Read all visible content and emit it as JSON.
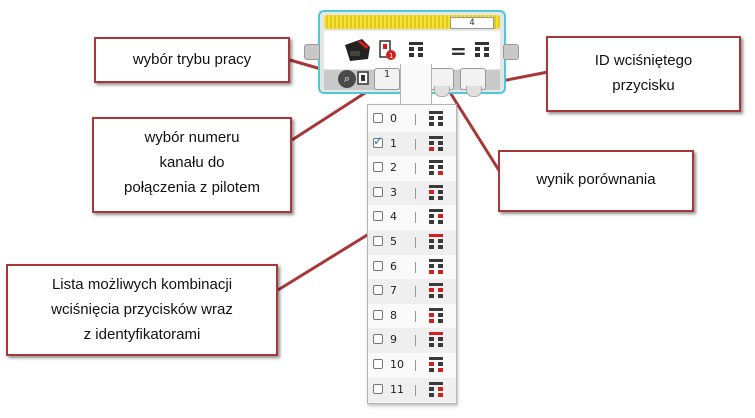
{
  "block": {
    "port_value": "4",
    "channel_value": "1",
    "colors": {
      "border": "#4fc8d8",
      "header": "#f4e23a",
      "button_off": "#3a3a3a",
      "button_on": "#d21f1f"
    }
  },
  "dropdown": {
    "rows": [
      {
        "label": "0",
        "checked": false,
        "pattern": [
          0,
          0,
          0,
          0,
          0
        ]
      },
      {
        "label": "1",
        "checked": true,
        "pattern": [
          0,
          0,
          0,
          1,
          0
        ]
      },
      {
        "label": "2",
        "checked": false,
        "pattern": [
          0,
          0,
          0,
          0,
          1
        ]
      },
      {
        "label": "3",
        "checked": false,
        "pattern": [
          0,
          1,
          0,
          0,
          0
        ]
      },
      {
        "label": "4",
        "checked": false,
        "pattern": [
          0,
          0,
          1,
          0,
          0
        ]
      },
      {
        "label": "5",
        "checked": false,
        "pattern": [
          1,
          0,
          0,
          0,
          0
        ]
      },
      {
        "label": "6",
        "checked": false,
        "pattern": [
          0,
          0,
          0,
          1,
          1
        ]
      },
      {
        "label": "7",
        "checked": false,
        "pattern": [
          0,
          1,
          1,
          0,
          0
        ]
      },
      {
        "label": "8",
        "checked": false,
        "pattern": [
          0,
          1,
          0,
          1,
          0
        ]
      },
      {
        "label": "9",
        "checked": false,
        "pattern": [
          1,
          0,
          0,
          0,
          0
        ]
      },
      {
        "label": "10",
        "checked": false,
        "pattern": [
          0,
          1,
          0,
          0,
          1
        ]
      },
      {
        "label": "11",
        "checked": false,
        "pattern": [
          0,
          0,
          1,
          0,
          1
        ]
      }
    ]
  },
  "callouts": {
    "mode": {
      "lines": [
        "wybór trybu pracy"
      ]
    },
    "channel": {
      "lines": [
        "wybór numeru",
        "kanału do",
        "połączenia z pilotem"
      ]
    },
    "list": {
      "lines": [
        "Lista możliwych kombinacji",
        "wciśnięcia przycisków wraz",
        "z identyfikatorami"
      ]
    },
    "button_id": {
      "lines": [
        "ID wciśniętego",
        "przycisku"
      ]
    },
    "result": {
      "lines": [
        "wynik porównania"
      ]
    },
    "border_color": "#a8373a"
  }
}
